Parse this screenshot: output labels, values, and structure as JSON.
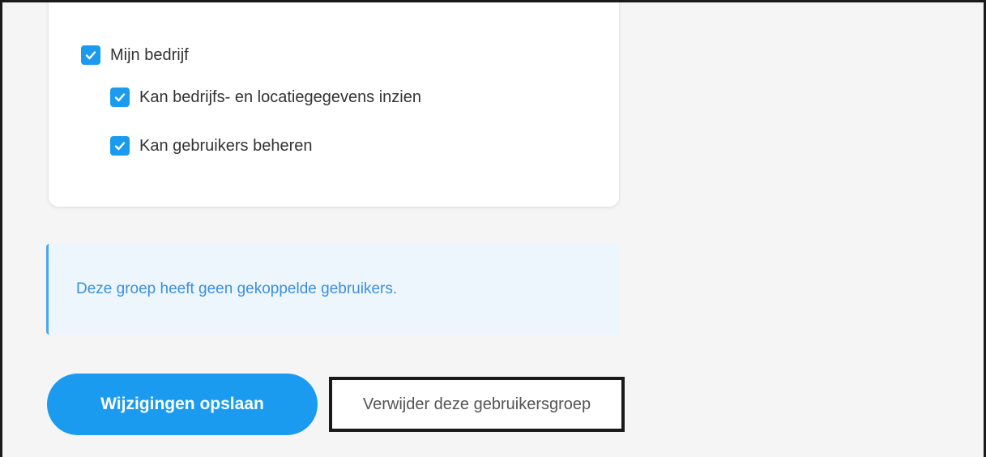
{
  "permissions": {
    "group": {
      "label": "Mijn bedrijf",
      "checked": true
    },
    "items": [
      {
        "label": "Kan bedrijfs- en locatiegegevens inzien",
        "checked": true
      },
      {
        "label": "Kan gebruikers beheren",
        "checked": true
      }
    ]
  },
  "notice": {
    "text": "Deze groep heeft geen gekoppelde gebruikers."
  },
  "actions": {
    "save_label": "Wijzigingen opslaan",
    "delete_label": "Verwijder deze gebruikersgroep"
  },
  "colors": {
    "accent": "#1a9bf0",
    "notice_bg": "#eef6fd",
    "notice_text": "#3b8fe0",
    "page_bg": "#f5f5f5"
  },
  "icons": {
    "checkbox": "check-icon"
  }
}
